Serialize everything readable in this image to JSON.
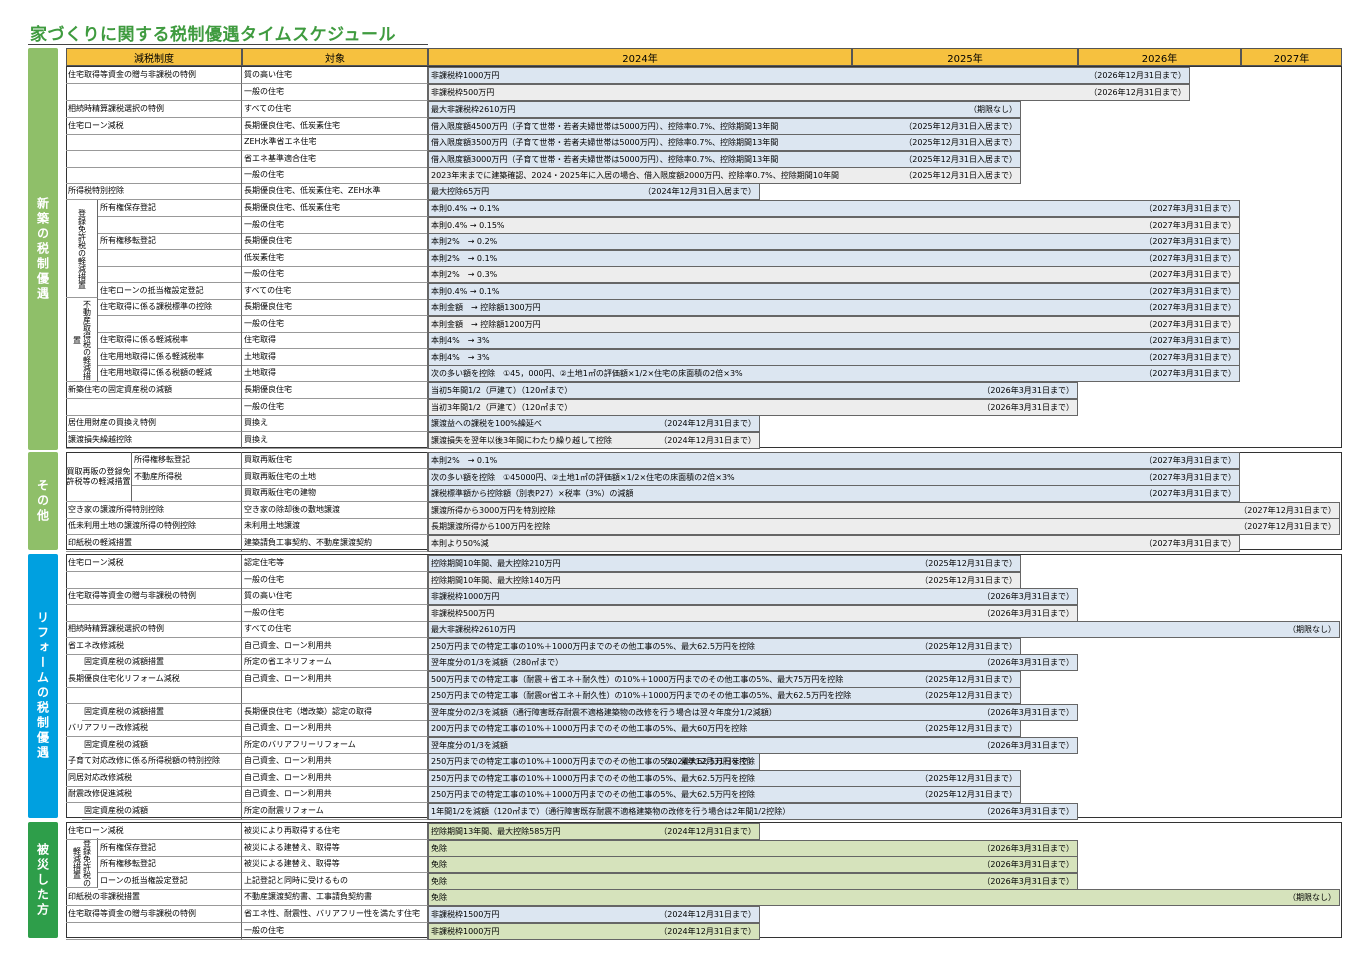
{
  "title": "家づくりに関する税制優遇タイムスケジュール",
  "header": {
    "system": "減税制度",
    "target": "対象",
    "y2024": "2024年",
    "y2025": "2025年",
    "y2026": "2026年",
    "y2027": "2027年"
  },
  "side": {
    "new": "新築の税制優遇",
    "other": "その他",
    "reform": "リフォームの税制優遇",
    "disaster": "被災した方"
  },
  "groups": {
    "reg1": "登録免許税の軽減措置",
    "fudo": "不動産取得税の軽減措置",
    "kaitori": "買取再販の登録免許税等の軽減措置",
    "reg2": "登録免許税の軽減措置"
  },
  "colors": {
    "accent": "#3f9b3f",
    "header": "#f6c13f",
    "new": "#8fbf69",
    "other": "#8fbf69",
    "reform": "#00a0e0",
    "disaster": "#2e9e4a",
    "blue": "#dce6f1",
    "gray": "#ededed",
    "green": "#d6e3bc"
  },
  "rows": [
    {
      "cat": "住宅取得等資金の贈与非課税の特例",
      "tgt": "質の高い住宅",
      "bar": "非課税枠1000万円",
      "date": "（2026年12月31日まで）"
    },
    {
      "cat": "",
      "tgt": "一般の住宅",
      "bar": "非課税枠500万円",
      "date": "（2026年12月31日まで）"
    },
    {
      "cat": "相続時精算課税選択の特例",
      "tgt": "すべての住宅",
      "bar": "最大非課税枠2610万円",
      "date": "（期限なし）"
    },
    {
      "cat": "住宅ローン減税",
      "tgt": "長期優良住宅、低炭素住宅",
      "bar": "借入限度額4500万円（子育て世帯・若者夫婦世帯は5000万円）、控除率0.7%、控除期間13年間",
      "date": "（2025年12月31日入居まで）"
    },
    {
      "cat": "",
      "tgt": "ZEH水準省エネ住宅",
      "bar": "借入限度額3500万円（子育て世帯・若者夫婦世帯は5000万円）、控除率0.7%、控除期間13年間",
      "date": "（2025年12月31日入居まで）"
    },
    {
      "cat": "",
      "tgt": "省エネ基準適合住宅",
      "bar": "借入限度額3000万円（子育て世帯・若者夫婦世帯は5000万円）、控除率0.7%、控除期間13年間",
      "date": "（2025年12月31日入居まで）"
    },
    {
      "cat": "",
      "tgt": "一般の住宅",
      "bar": "2023年末までに建築確認、2024・2025年に入居の場合、借入限度額2000万円、控除率0.7%、控除期間10年間",
      "date": "（2025年12月31日入居まで）"
    },
    {
      "cat": "所得税特別控除",
      "tgt": "長期優良住宅、低炭素住宅、ZEH水準",
      "bar": "最大控除65万円",
      "date": "（2024年12月31日入居まで）"
    },
    {
      "cat": "所有権保存登記",
      "tgt": "長期優良住宅、低炭素住宅",
      "bar": "本則0.4% → 0.1%",
      "date": "（2027年3月31日まで）"
    },
    {
      "cat": "",
      "tgt": "一般の住宅",
      "bar": "本則0.4% → 0.15%",
      "date": "（2027年3月31日まで）"
    },
    {
      "cat": "所有権移転登記",
      "tgt": "長期優良住宅",
      "bar": "本則2%　→ 0.2%",
      "date": "（2027年3月31日まで）"
    },
    {
      "cat": "",
      "tgt": "低炭素住宅",
      "bar": "本則2%　→ 0.1%",
      "date": "（2027年3月31日まで）"
    },
    {
      "cat": "",
      "tgt": "一般の住宅",
      "bar": "本則2%　→ 0.3%",
      "date": "（2027年3月31日まで）"
    },
    {
      "cat": "住宅ローンの抵当権設定登記",
      "tgt": "すべての住宅",
      "bar": "本則0.4% → 0.1%",
      "date": "（2027年3月31日まで）"
    },
    {
      "cat": "住宅取得に係る課税標準の控除",
      "tgt": "長期優良住宅",
      "bar": "本則金額　→ 控除額1300万円",
      "date": "（2027年3月31日まで）"
    },
    {
      "cat": "",
      "tgt": "一般の住宅",
      "bar": "本則金額　→ 控除額1200万円",
      "date": "（2027年3月31日まで）"
    },
    {
      "cat": "住宅取得に係る軽減税率",
      "tgt": "住宅取得",
      "bar": "本則4%　→ 3%",
      "date": "（2027年3月31日まで）"
    },
    {
      "cat": "住宅用地取得に係る軽減税率",
      "tgt": "土地取得",
      "bar": "本則4%　→ 3%",
      "date": "（2027年3月31日まで）"
    },
    {
      "cat": "住宅用地取得に係る税額の軽減",
      "tgt": "土地取得",
      "bar": "次の多い額を控除　①45，000円、②土地1㎡の評価額×1/2×住宅の床面積の2倍×3%",
      "date": "（2027年3月31日まで）"
    },
    {
      "cat": "新築住宅の固定資産税の減額",
      "tgt": "長期優良住宅",
      "bar": "当初5年間1/2（戸建て）（120㎡まで）",
      "date": "（2026年3月31日まで）"
    },
    {
      "cat": "",
      "tgt": "一般の住宅",
      "bar": "当初3年間1/2（戸建て）（120㎡まで）",
      "date": "（2026年3月31日まで）"
    },
    {
      "cat": "居住用財産の買換え特例",
      "tgt": "買換え",
      "bar": "譲渡益への課税を100%繰延べ",
      "date": "（2024年12月31日まで）"
    },
    {
      "cat": "譲渡損失繰越控除",
      "tgt": "買換え",
      "bar": "譲渡損失を翌年以後3年間にわたり繰り越して控除",
      "date": "（2024年12月31日まで）"
    },
    {
      "cat": "所得権移転登記",
      "tgt": "買取再販住宅",
      "bar": "本則2%　→ 0.1%",
      "date": "（2027年3月31日まで）"
    },
    {
      "cat": "不動産所得税",
      "tgt": "買取再販住宅の土地",
      "bar": "次の多い額を控除　①45000円、②土地1㎡の評価額×1/2×住宅の床面積の2倍×3%",
      "date": "（2027年3月31日まで）"
    },
    {
      "cat": "",
      "tgt": "買取再販住宅の建物",
      "bar": "課税標準額から控除額（別表P27）×税率（3%）の減額",
      "date": "（2027年3月31日まで）"
    },
    {
      "cat": "空き家の譲渡所得特別控除",
      "tgt": "空き家の除却後の敷地譲渡",
      "bar": "譲渡所得から3000万円を特別控除",
      "date": "（2027年12月31日まで）"
    },
    {
      "cat": "低未利用土地の譲渡所得の特例控除",
      "tgt": "未利用土地譲渡",
      "bar": "長期譲渡所得から100万円を控除",
      "date": "（2027年12月31日まで）"
    },
    {
      "cat": "印紙税の軽減措置",
      "tgt": "建築請負工事契約、不動産譲渡契約",
      "bar": "本則より50%減",
      "date": "（2027年3月31日まで）"
    },
    {
      "cat": "住宅ローン減税",
      "tgt": "認定住宅等",
      "bar": "控除期間10年間、最大控除210万円",
      "date": "（2025年12月31日まで）"
    },
    {
      "cat": "",
      "tgt": "一般の住宅",
      "bar": "控除期間10年間、最大控除140万円",
      "date": "（2025年12月31日まで）"
    },
    {
      "cat": "住宅取得等資金の贈与非課税の特例",
      "tgt": "質の高い住宅",
      "bar": "非課税枠1000万円",
      "date": "（2026年3月31日まで）"
    },
    {
      "cat": "",
      "tgt": "一般の住宅",
      "bar": "非課税枠500万円",
      "date": "（2026年3月31日まで）"
    },
    {
      "cat": "相続時精算課税選択の特例",
      "tgt": "すべての住宅",
      "bar": "最大非課税枠2610万円",
      "date": "（期限なし）"
    },
    {
      "cat": "省エネ改修減税",
      "tgt": "自己資金、ローン利用共",
      "bar": "250万円までの特定工事の10%＋1000万円までのその他工事の5%、最大62.5万円を控除",
      "date": "（2025年12月31日まで）"
    },
    {
      "cat": "固定資産税の減額措置",
      "tgt": "所定の省エネリフォーム",
      "bar": "翌年度分の1/3を減額（280㎡まで）",
      "date": "（2026年3月31日まで）"
    },
    {
      "cat": "長期優良住宅化リフォーム減税",
      "tgt": "自己資金、ローン利用共",
      "bar": "500万円までの特定工事（耐震＋省エネ＋耐久性）の10%＋1000万円までのその他工事の5%、最大75万円を控除",
      "date": "（2025年12月31日まで）"
    },
    {
      "cat": "",
      "tgt": "",
      "bar": "250万円までの特定工事（耐震or省エネ＋耐久性）の10%＋1000万円までのその他工事の5%、最大62.5万円を控除",
      "date": "（2025年12月31日まで）"
    },
    {
      "cat": "固定資産税の減額措置",
      "tgt": "長期優良住宅（増改築）認定の取得",
      "bar": "翌年度分の2/3を減額（通行障害既存耐震不適格建築物の改修を行う場合は翌々年度分1/2減額）",
      "date": "（2026年3月31日まで）"
    },
    {
      "cat": "バリアフリー改修減税",
      "tgt": "自己資金、ローン利用共",
      "bar": "200万円までの特定工事の10%＋1000万円までのその他工事の5%、最大60万円を控除",
      "date": "（2025年12月31日まで）"
    },
    {
      "cat": "固定資産税の減額",
      "tgt": "所定のバリアフリーリフォーム",
      "bar": "翌年度分の1/3を減額",
      "date": "（2026年3月31日まで）"
    },
    {
      "cat": "子育て対応改修に係る所得税額の特別控除",
      "tgt": "自己資金、ローン利用共",
      "bar": "250万円までの特定工事の10%＋1000万円までのその他工事の5%、最大62.5万円を控除",
      "date": "（2024年12月31日まで）"
    },
    {
      "cat": "同居対応改修減税",
      "tgt": "自己資金、ローン利用共",
      "bar": "250万円までの特定工事の10%＋1000万円までのその他工事の5%、最大62.5万円を控除",
      "date": "（2025年12月31日まで）"
    },
    {
      "cat": "耐震改修促進減税",
      "tgt": "自己資金、ローン利用共",
      "bar": "250万円までの特定工事の10%＋1000万円までのその他工事の5%、最大62.5万円を控除",
      "date": "（2025年12月31日まで）"
    },
    {
      "cat": "固定資産税の減額",
      "tgt": "所定の耐震リフォーム",
      "bar": "1年間1/2を減額（120㎡まで）（通行障害既存耐震不適格建築物の改修を行う場合は2年間1/2控除）",
      "date": "（2026年3月31日まで）"
    },
    {
      "cat": "住宅ローン減税",
      "tgt": "被災により再取得する住宅",
      "bar": "控除期間13年間、最大控除585万円",
      "date": "（2024年12月31日まで）"
    },
    {
      "cat": "所有権保存登記",
      "tgt": "被災による建替え、取得等",
      "bar": "免除",
      "date": "（2026年3月31日まで）"
    },
    {
      "cat": "所有権移転登記",
      "tgt": "被災による建替え、取得等",
      "bar": "免除",
      "date": "（2026年3月31日まで）"
    },
    {
      "cat": "ローンの抵当権設定登記",
      "tgt": "上記登記と同時に受けるもの",
      "bar": "免除",
      "date": "（2026年3月31日まで）"
    },
    {
      "cat": "印紙税の非課税措置",
      "tgt": "不動産譲渡契約書、工事請負契約書",
      "bar": "免除",
      "date": "（期限なし）"
    },
    {
      "cat": "住宅取得等資金の贈与非課税の特例",
      "tgt": "省エネ性、耐震性、バリアフリー性を満たす住宅",
      "bar": "非課税枠1500万円",
      "date": "（2024年12月31日まで）"
    },
    {
      "cat": "",
      "tgt": "一般の住宅",
      "bar": "非課税枠1000万円",
      "date": "（2024年12月31日まで）"
    }
  ]
}
